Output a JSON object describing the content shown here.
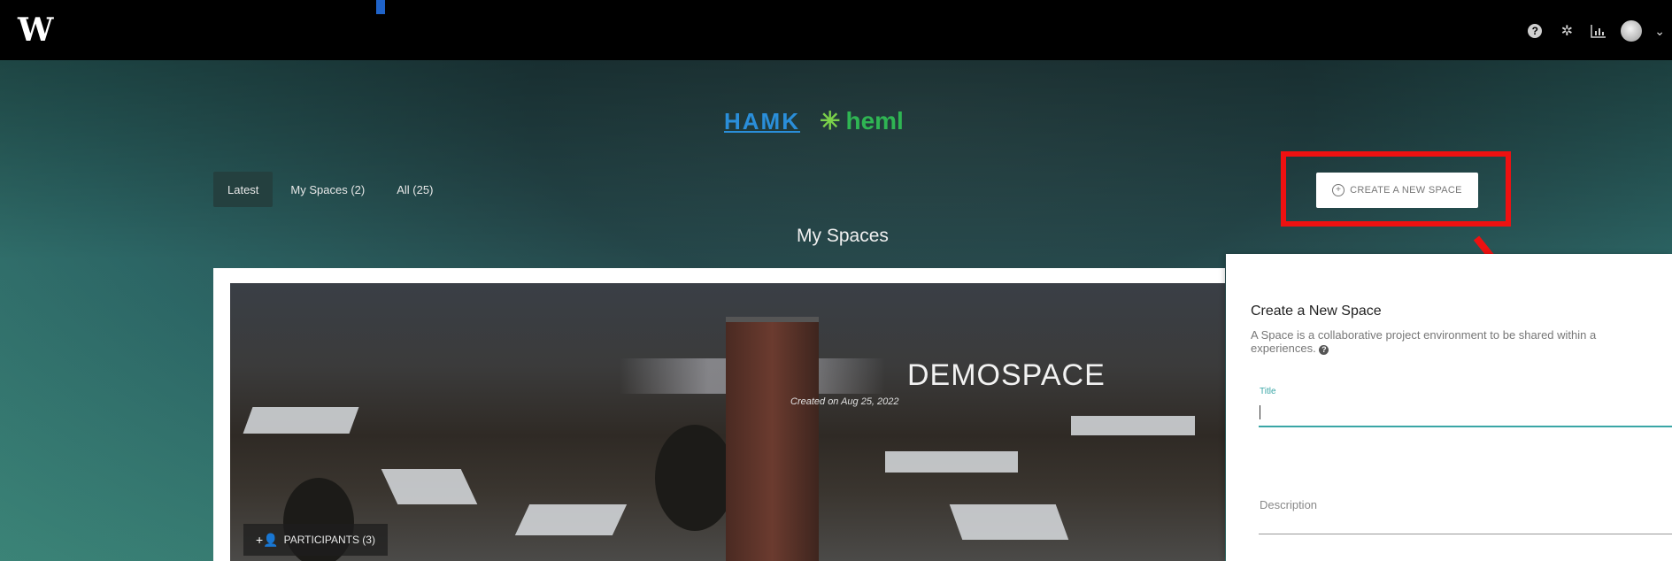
{
  "app": {
    "logo_text": "W",
    "icons": [
      "help-icon",
      "gear-icon",
      "analytics-icon",
      "avatar",
      "chevron-down-icon"
    ]
  },
  "hero": {
    "partner_logos": {
      "hamk": "HAMK",
      "heml": "heml"
    },
    "tabs": [
      {
        "label": "Latest",
        "active": true
      },
      {
        "label": "My Spaces (2)",
        "active": false
      },
      {
        "label": "All (25)",
        "active": false
      }
    ],
    "section_title": "My Spaces"
  },
  "create_button": {
    "label": "CREATE A NEW SPACE"
  },
  "space_card": {
    "name": "DEMOSPACE",
    "created": "Created on Aug 25, 2022",
    "participants_label": "PARTICIPANTS (3)"
  },
  "panel": {
    "title": "Create a New Space",
    "description": "A Space is a collaborative project environment to be shared within a",
    "description_line2": "experiences.",
    "title_label": "Title",
    "title_value": "",
    "description_label": "Description"
  },
  "colors": {
    "accent_teal": "#3aa6a6",
    "highlight_red": "#ee1111",
    "topbar": "#000000"
  }
}
